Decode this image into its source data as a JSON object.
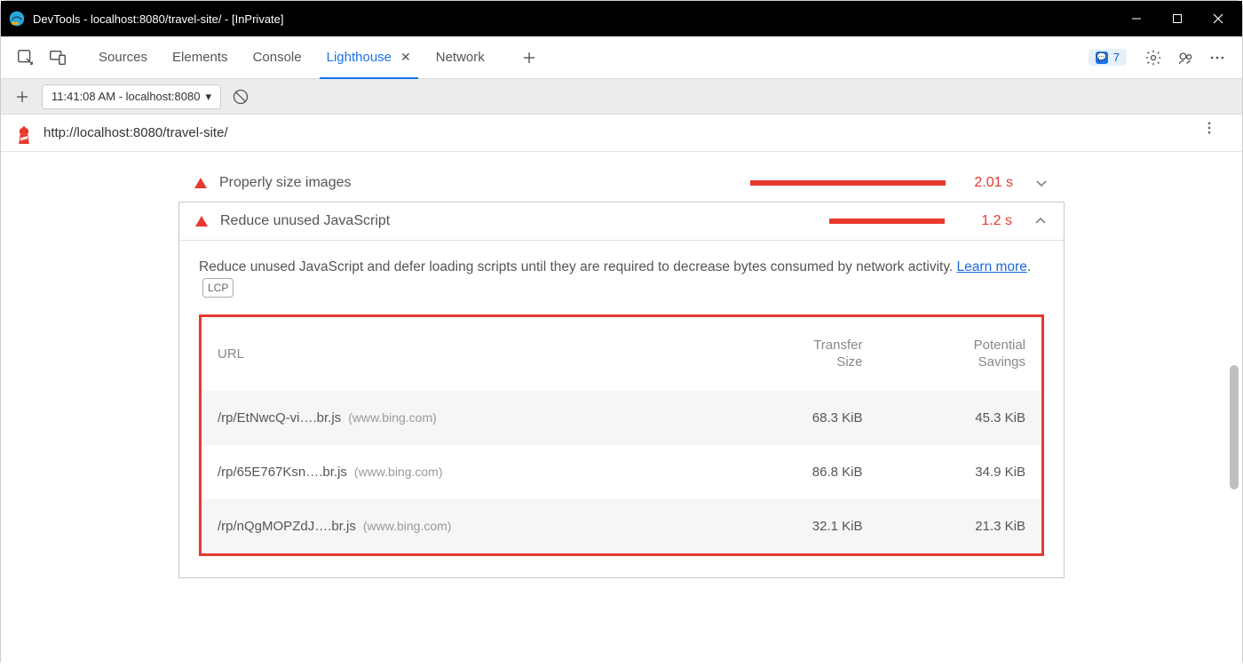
{
  "window": {
    "title": "DevTools - localhost:8080/travel-site/ - [InPrivate]"
  },
  "tabs": {
    "items": [
      "Sources",
      "Elements",
      "Console",
      "Lighthouse",
      "Network"
    ],
    "active": "Lighthouse",
    "issues_count": "7"
  },
  "toolbar2": {
    "report_label": "11:41:08 AM - localhost:8080"
  },
  "urlbar": {
    "url": "http://localhost:8080/travel-site/"
  },
  "audits": {
    "collapsed": {
      "title": "Properly size images",
      "metric": "2.01 s"
    },
    "expanded": {
      "title": "Reduce unused JavaScript",
      "metric": "1.2 s",
      "description": "Reduce unused JavaScript and defer loading scripts until they are required to decrease bytes consumed by network activity. ",
      "learn_more": "Learn more",
      "badge": "LCP",
      "table": {
        "headers": {
          "url": "URL",
          "transfer_l1": "Transfer",
          "transfer_l2": "Size",
          "savings_l1": "Potential",
          "savings_l2": "Savings"
        },
        "rows": [
          {
            "path": "/rp/EtNwcQ-vi….br.js",
            "domain": "(www.bing.com)",
            "transfer": "68.3 KiB",
            "savings": "45.3 KiB"
          },
          {
            "path": "/rp/65E767Ksn….br.js",
            "domain": "(www.bing.com)",
            "transfer": "86.8 KiB",
            "savings": "34.9 KiB"
          },
          {
            "path": "/rp/nQgMOPZdJ….br.js",
            "domain": "(www.bing.com)",
            "transfer": "32.1 KiB",
            "savings": "21.3 KiB"
          }
        ]
      }
    }
  }
}
